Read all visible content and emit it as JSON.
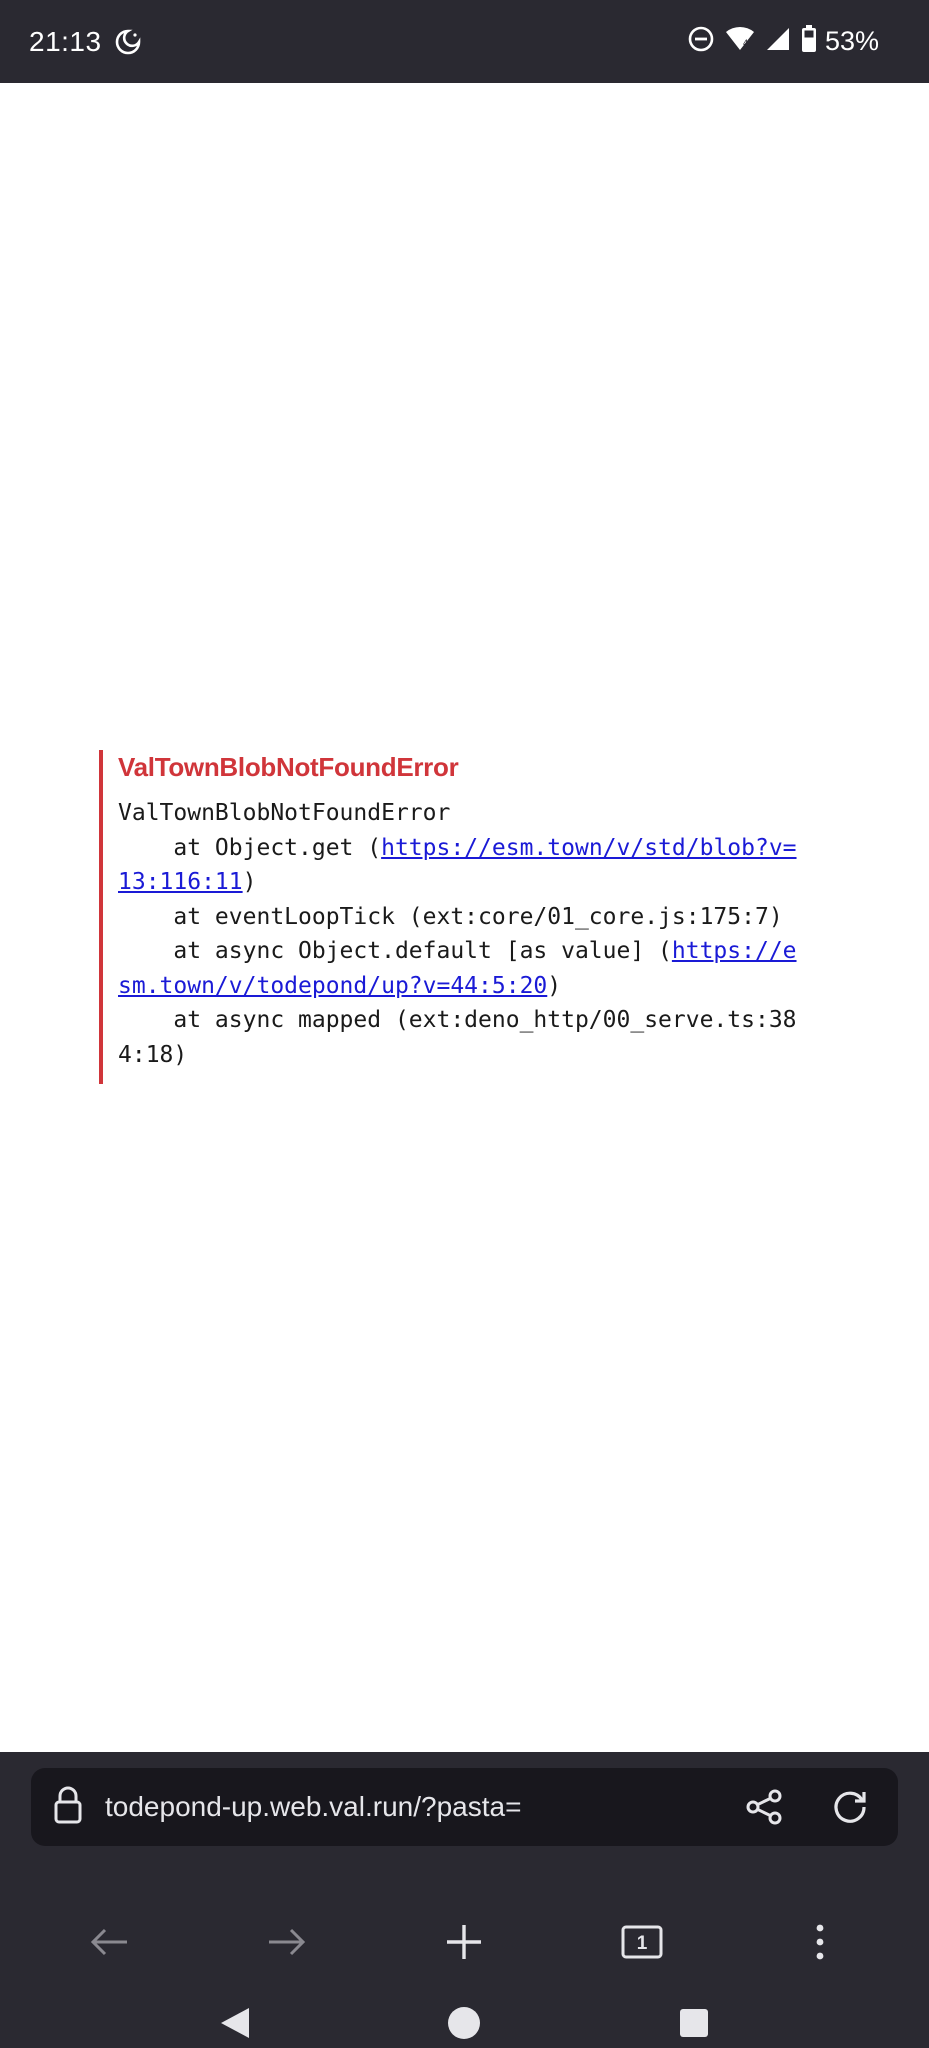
{
  "status_bar": {
    "time": "21:13",
    "battery": "53%",
    "icons": [
      "night-mode-icon",
      "do-not-disturb-icon",
      "wifi-icon",
      "signal-icon",
      "battery-icon"
    ]
  },
  "error": {
    "title": "ValTownBlobNotFoundError",
    "stack_header": "ValTownBlobNotFoundError",
    "line1_prefix": "    at Object.get (",
    "line1_link": "https://esm.town/v/std/blob?v=13:116:11",
    "line1_suffix": ")",
    "line2": "    at eventLoopTick (ext:core/01_core.js:175:7)",
    "line3_prefix": "    at async Object.default [as value] (",
    "line3_link": "https://esm.town/v/todepond/up?v=44:5:20",
    "line3_suffix": ")",
    "line4": "    at async mapped (ext:deno_http/00_serve.ts:384:18)",
    "color": "#d0353a",
    "link_color": "#1a1ad6"
  },
  "browser": {
    "url": "todepond-up.web.val.run/?pasta=",
    "tab_count": "1",
    "chrome_color": "#2a2931"
  }
}
